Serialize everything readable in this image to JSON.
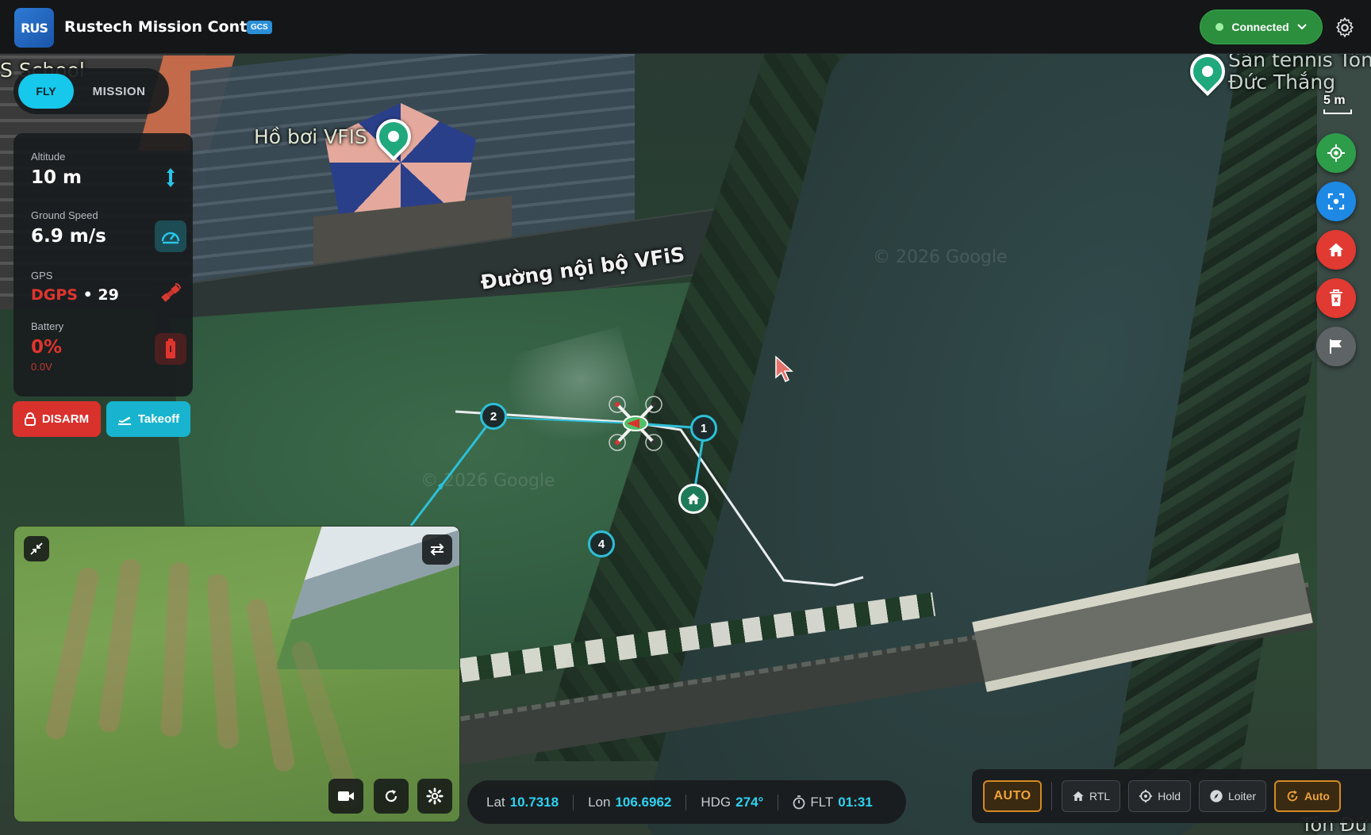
{
  "app": {
    "logo_text": "RUS",
    "title": "Rustech Mission Control",
    "badge": "GCS"
  },
  "connection": {
    "label": "Connected",
    "status_color": "#2c8f3e"
  },
  "mode_toggle": {
    "fly_label": "FLY",
    "mission_label": "MISSION",
    "active": "FLY"
  },
  "telemetry": {
    "altitude": {
      "label": "Altitude",
      "value": "10 m",
      "icon": "altitude-arrows-icon"
    },
    "ground_speed": {
      "label": "Ground Speed",
      "value": "6.9 m/s",
      "icon": "speedometer-icon"
    },
    "gps": {
      "label": "GPS",
      "fix": "DGPS",
      "separator": "•",
      "satellites": "29",
      "icon": "satellite-icon"
    },
    "battery": {
      "label": "Battery",
      "percent": "0%",
      "voltage": "0.0V",
      "icon": "battery-icon",
      "status_color": "#e0352e"
    }
  },
  "actions": {
    "disarm_label": "DISARM",
    "takeoff_label": "Takeoff"
  },
  "map": {
    "labels": {
      "road": "Đường nội bộ VFiS",
      "pool": "Hồ bơi VFIS",
      "tennis_line1": "Sân tennis Tôn",
      "tennis_line2": "Đức Thắng",
      "school": "S School",
      "watermark1": "© 2026 Google",
      "watermark2": "© 2026 Google",
      "bottom_right": "Tôn Đứ"
    },
    "scale": "5 m",
    "waypoints": [
      "1",
      "2",
      "4"
    ],
    "home_icon": "home-icon"
  },
  "status_bar": {
    "lat_label": "Lat",
    "lat_value": "10.7318",
    "lon_label": "Lon",
    "lon_value": "106.6962",
    "hdg_label": "HDG",
    "hdg_value": "274°",
    "flt_label": "FLT",
    "flt_value": "01:31"
  },
  "flight_modes": {
    "current": "AUTO",
    "buttons": [
      {
        "label": "RTL",
        "icon": "home-icon"
      },
      {
        "label": "Hold",
        "icon": "crosshair-icon"
      },
      {
        "label": "Loiter",
        "icon": "compass-icon"
      },
      {
        "label": "Auto",
        "icon": "auto-cycle-icon"
      }
    ]
  },
  "fabs": [
    "locate-icon",
    "focus-icon",
    "home-icon",
    "trash-icon",
    "flag-icon"
  ],
  "colors": {
    "accent": "#16c8ec",
    "danger": "#e03a33",
    "warning": "#f0a23a",
    "success": "#2c8f3e"
  }
}
